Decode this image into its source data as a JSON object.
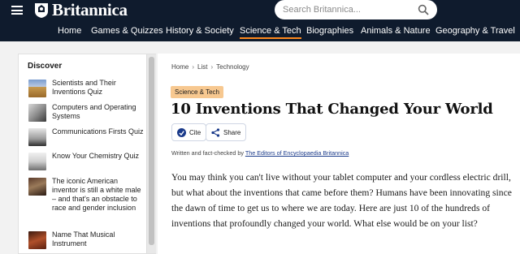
{
  "header": {
    "logo_text": "Britannica",
    "search_placeholder": "Search Britannica...",
    "nav": [
      "Home",
      "Games & Quizzes",
      "History & Society",
      "Science & Tech",
      "Biographies",
      "Animals & Nature",
      "Geography & Travel"
    ],
    "active_nav": "Science & Tech",
    "colors": {
      "header_bg": "#0f1b2d",
      "accent": "#ff8a1e"
    }
  },
  "sidebar": {
    "heading": "Discover",
    "items": [
      {
        "label": "Scientists and Their Inventions Quiz",
        "thumb": "clock-tower-thumb"
      },
      {
        "label": "Computers and Operating Systems",
        "thumb": "computer-thumb"
      },
      {
        "label": "Communications Firsts Quiz",
        "thumb": "telephone-thumb"
      },
      {
        "label": "Know Your Chemistry Quiz",
        "thumb": "chemistry-flask-thumb"
      },
      {
        "label": "The iconic American inventor is still a white male – and that's an obstacle to race and gender inclusion",
        "thumb": "inventor-portrait-thumb"
      },
      {
        "label": "Name That Musical Instrument",
        "thumb": "instrument-thumb"
      }
    ]
  },
  "article": {
    "breadcrumb": [
      "Home",
      "List",
      "Technology"
    ],
    "category_badge": "Science & Tech",
    "title": "10 Inventions That Changed Your World",
    "cite_label": "Cite",
    "share_label": "Share",
    "byline_prefix": "Written and fact-checked by",
    "byline_author": "The Editors of Encyclopaedia Britannica",
    "body": "You may think you can't live without your tablet computer and your cordless electric drill, but what about the inventions that came before them? Humans have been innovating since the dawn of time to get us to where we are today. Here are just 10 of the hundreds of inventions that profoundly changed your world. What else would be on your list?"
  }
}
